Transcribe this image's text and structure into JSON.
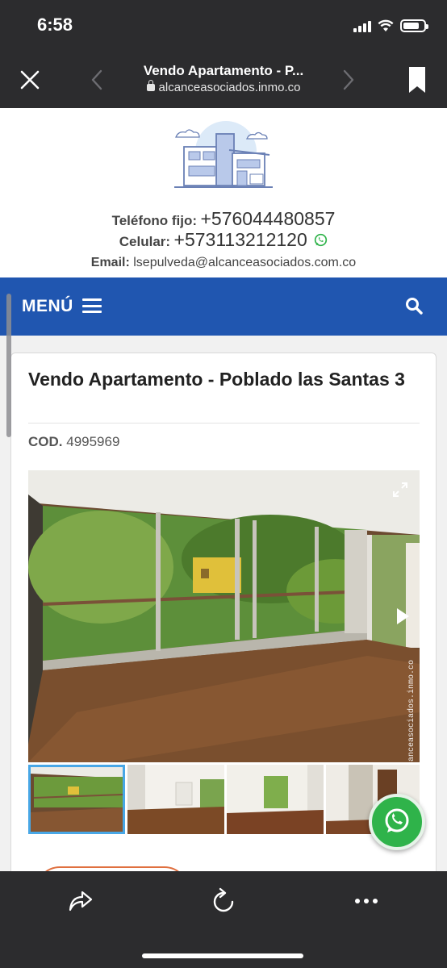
{
  "status_bar": {
    "time": "6:58",
    "battery_level": 0.8
  },
  "browser": {
    "title": "Vendo Apartamento - P...",
    "url": "alcanceasociados.inmo.co"
  },
  "site": {
    "fixed_phone_label": "Teléfono fijo:",
    "fixed_phone": "+576044480857",
    "mobile_label": "Celular:",
    "mobile": "+573113212120",
    "email_label": "Email:",
    "email": "lsepulveda@alcanceasociados.com.co"
  },
  "menu": {
    "label": "MENÚ"
  },
  "property": {
    "title": "Vendo Apartamento - Poblado las Santas 3",
    "cod_label": "COD.",
    "cod_value": "4995969",
    "watermark": "alcanceasociados.inmo.co"
  },
  "icons": {
    "close": "close-icon",
    "back": "chevron-left-icon",
    "forward": "chevron-right-icon",
    "bookmark": "bookmark-icon",
    "search": "search-icon",
    "menu": "hamburger-icon",
    "whatsapp": "whatsapp-icon",
    "expand": "expand-icon",
    "share": "share-icon",
    "reload": "reload-icon",
    "more": "more-icon"
  },
  "colors": {
    "menu_bar": "#2056b0",
    "whatsapp": "#2fb34a",
    "thumb_active": "#48a7e6",
    "browser_chrome": "#2c2c2e"
  }
}
